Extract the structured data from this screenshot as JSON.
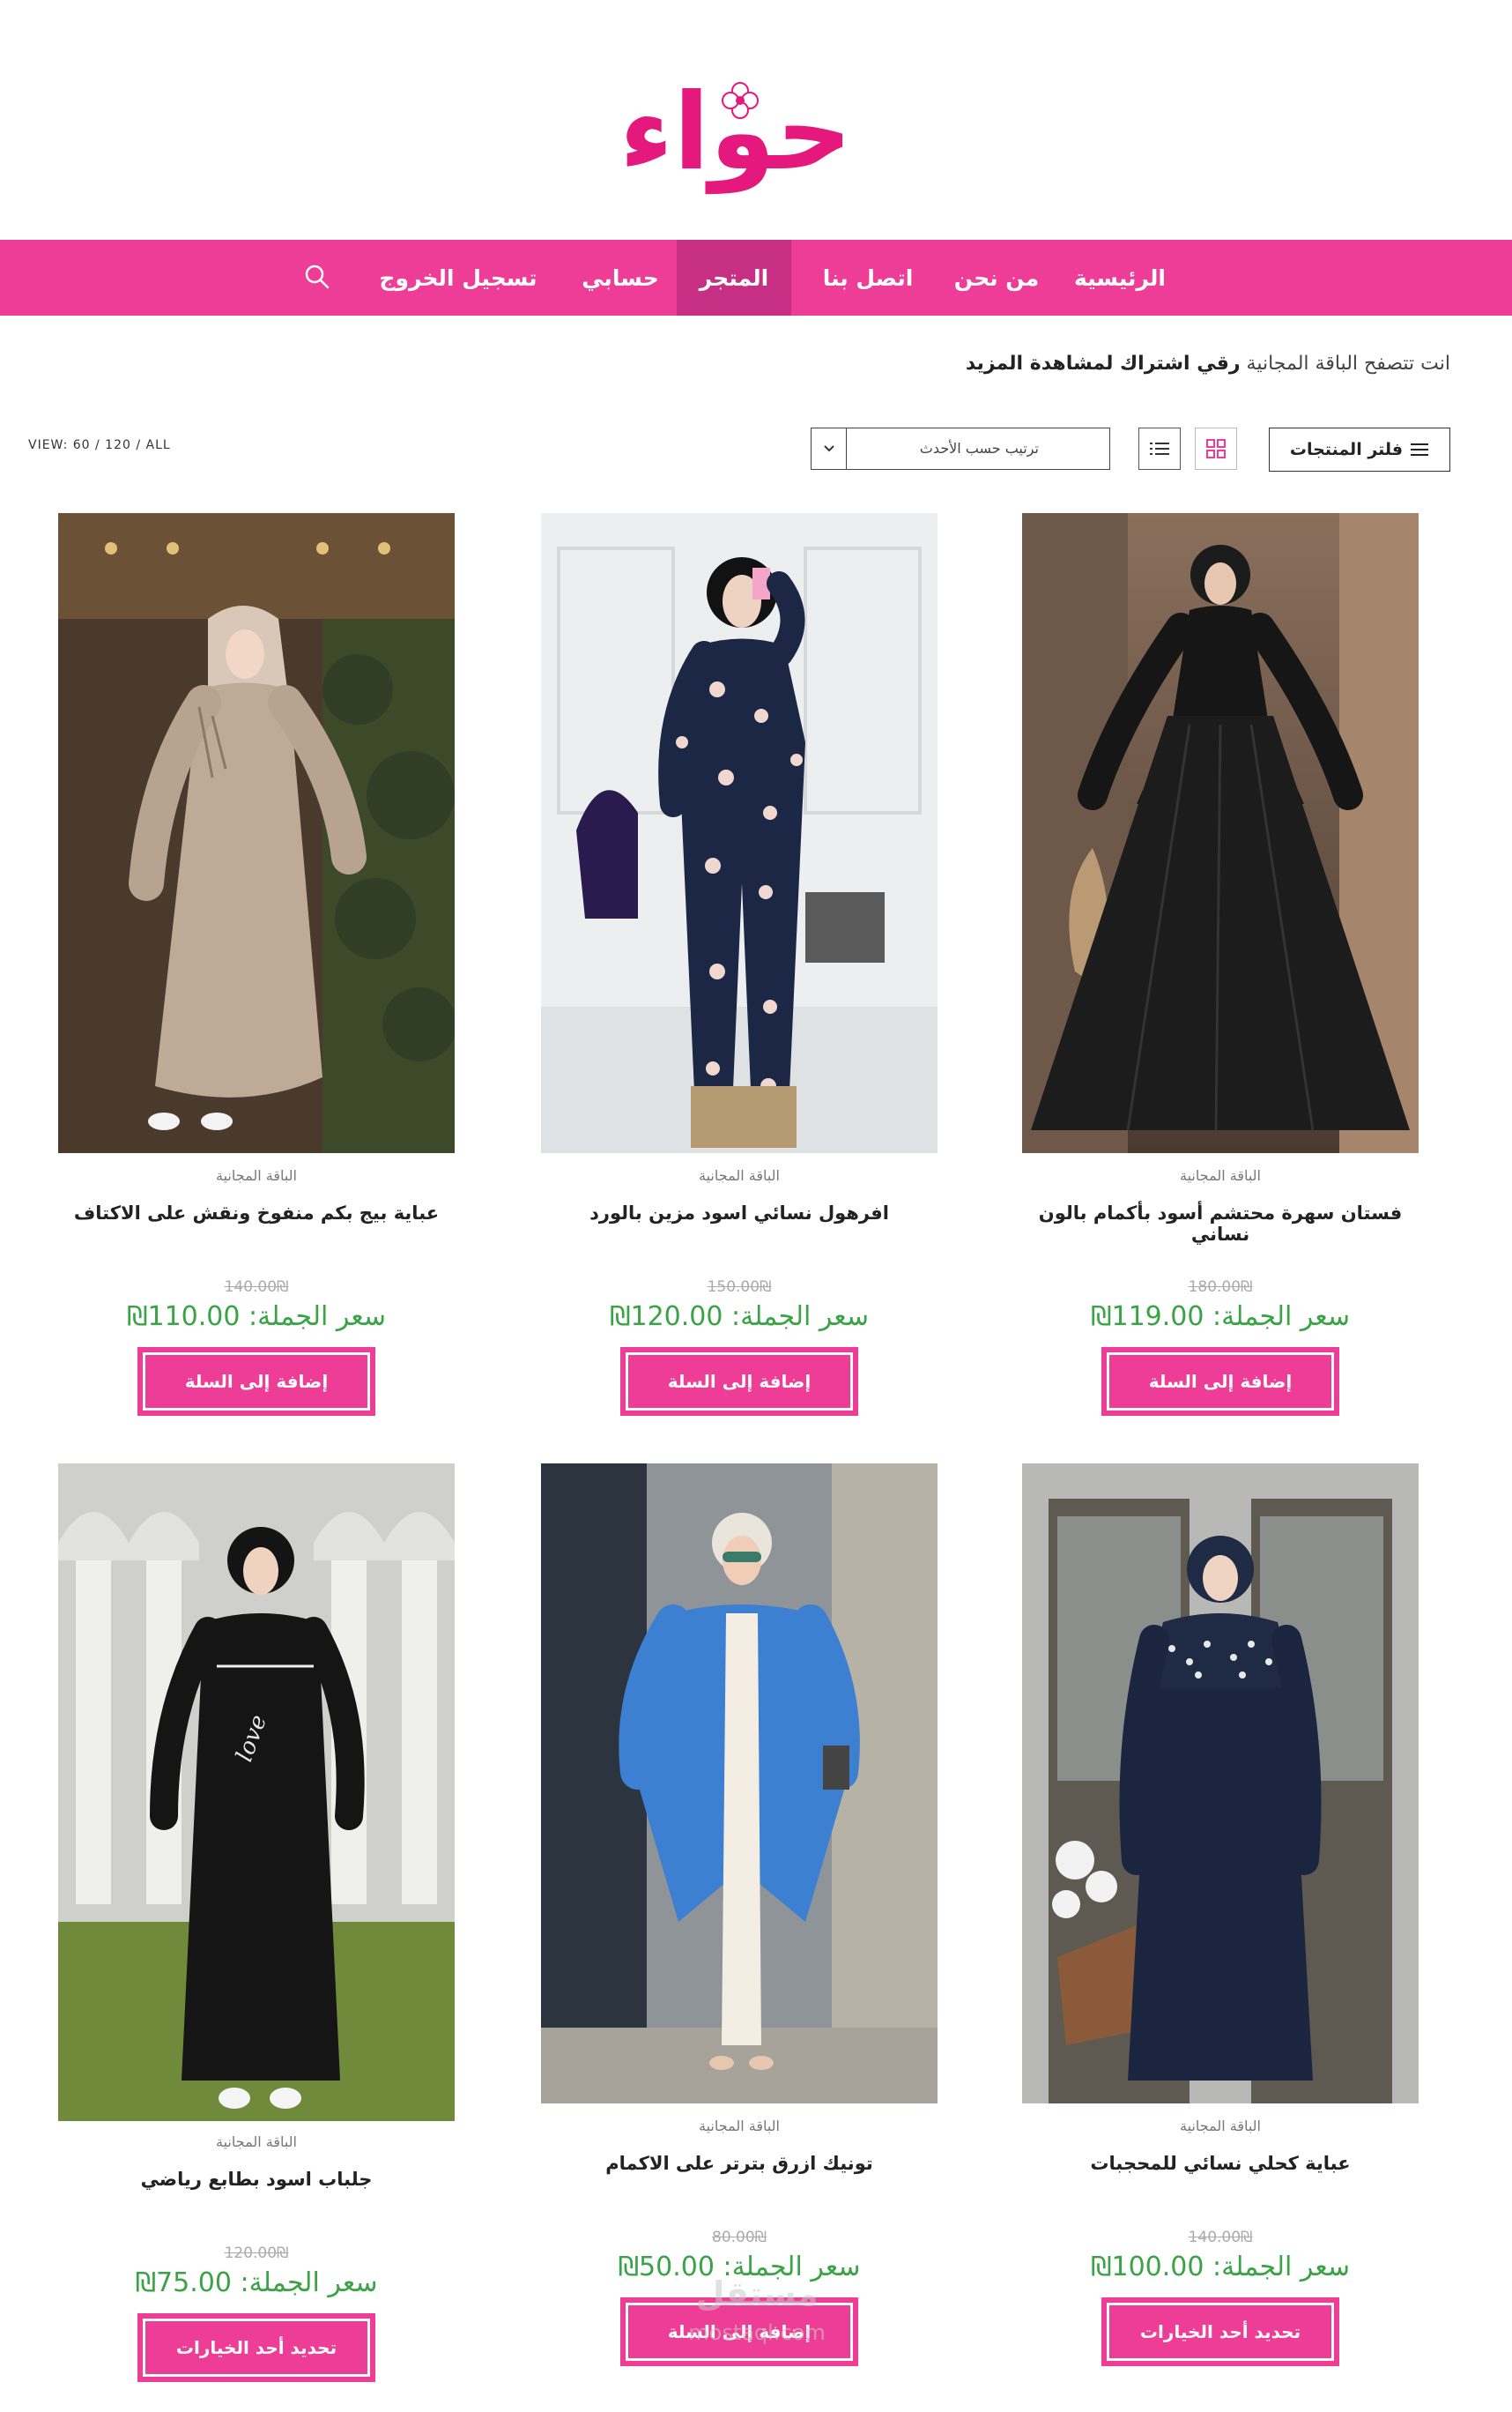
{
  "brand": {
    "logo_text": "حواء",
    "accent": "#ee3d96",
    "accent_dark": "#c62f83",
    "price_color": "#3aa346"
  },
  "nav": {
    "items": [
      {
        "label": "الرئيسية",
        "active": false
      },
      {
        "label": "من نحن",
        "active": false
      },
      {
        "label": "اتصل بنا",
        "active": false
      },
      {
        "label": "المتجر",
        "active": true
      },
      {
        "label": "حسابي",
        "active": false
      },
      {
        "label": "تسجيل الخروج",
        "active": false
      }
    ],
    "search_icon": "search-icon"
  },
  "notice": {
    "text": "انت تتصفح الباقة المجانية",
    "bold": "رقي اشتراك لمشاهدة المزيد"
  },
  "toolbar": {
    "view_info": "VIEW: 60 / 120 / ALL",
    "sort_label": "ترتيب حسب الأحدث",
    "filter_label": "فلتر المنتجات"
  },
  "products": [
    {
      "category": "الباقة المجانية",
      "title": "فستان سهرة محتشم أسود بأكمام بالون نساني",
      "old_price": "180.00₪",
      "price": "سعر الجملة: 119.00₪",
      "button": "إضافة إلى السلة"
    },
    {
      "category": "الباقة المجانية",
      "title": "افرهول نسائي اسود مزين بالورد",
      "old_price": "150.00₪",
      "price": "سعر الجملة: 120.00₪",
      "button": "إضافة إلى السلة"
    },
    {
      "category": "الباقة المجانية",
      "title": "عباية بيج بكم منفوخ ونقش على الاكتاف",
      "old_price": "140.00₪",
      "price": "سعر الجملة: 110.00₪",
      "button": "إضافة إلى السلة"
    },
    {
      "category": "الباقة المجانية",
      "title": "عباية كحلي نسائي للمحجبات",
      "old_price": "140.00₪",
      "price": "سعر الجملة: 100.00₪",
      "button": "تحديد أحد الخيارات"
    },
    {
      "category": "الباقة المجانية",
      "title": "تونيك ازرق بترتر على الاكمام",
      "old_price": "80.00₪",
      "price": "سعر الجملة: 50.00₪",
      "button": "إضافة إلى السلة"
    },
    {
      "category": "الباقة المجانية",
      "title": "جلباب اسود بطابع رياضي",
      "old_price": "120.00₪",
      "price": "سعر الجملة: 75.00₪",
      "button": "تحديد أحد الخيارات"
    }
  ],
  "watermark": {
    "text": "مستقل",
    "sub": "mostaql.com"
  }
}
